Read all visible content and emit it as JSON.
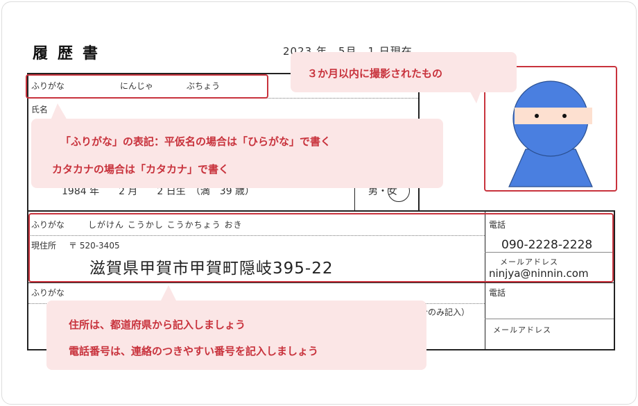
{
  "header": {
    "title": "履歴書",
    "date": "2023 年　5月　1 日現在"
  },
  "name_section": {
    "furigana_label": "ふりがな",
    "furigana_value": "にんじゃ　　　　ぶちょう",
    "name_label": "氏名",
    "birth_date": "1984 年　　2 月　　2 日生　（満　39 歳）",
    "gender": "男・女"
  },
  "address_section": {
    "furigana_label": "ふりがな",
    "furigana_value": "しがけん こうかし こうかちょう おき",
    "address_label": "現住所",
    "postal": "〒 520-3405",
    "address": "滋賀県甲賀市甲賀町隠岐395-22",
    "phone_label": "電話",
    "phone": "090-2228-2228",
    "email_label": "メールアドレス",
    "email": "ninjya@ninnin.com"
  },
  "contact_section": {
    "furigana_label": "ふりがな",
    "note_fragment": "合のみ記入）",
    "phone_label": "電話",
    "email_label": "メールアドレス"
  },
  "callouts": {
    "photo": "３か月以内に撮影されたもの",
    "furigana_line1": "「ふりがな」の表記：平仮名の場合は「ひらがな」で書く",
    "furigana_line2": "カタカナの場合は「カタカナ」で書く",
    "address_line1": "住所は、都道府県から記入しましょう",
    "address_line2": "電話番号は、連絡のつきやすい番号を記入しましょう"
  },
  "colors": {
    "accent": "#c8323c",
    "callout_bg": "#fbe6e6",
    "ninja_blue": "#4a7fe0",
    "ninja_skin": "#fde0d0"
  }
}
